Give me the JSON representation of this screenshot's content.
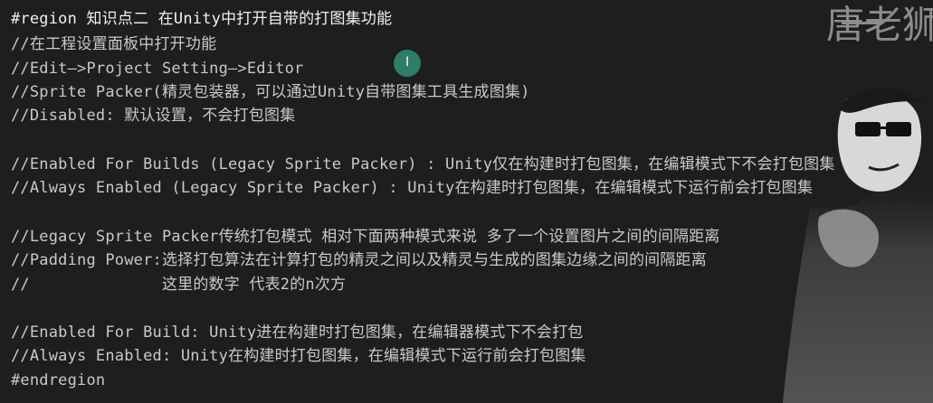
{
  "editor": {
    "lines": [
      {
        "id": "l1",
        "text": "#region 知识点二 在Unity中打开自带的打图集功能",
        "kind": "region-title"
      },
      {
        "id": "l2",
        "text": "//在工程设置面板中打开功能",
        "kind": "comment"
      },
      {
        "id": "l3",
        "text": "//Edit—>Project Setting—>Editor",
        "kind": "comment"
      },
      {
        "id": "l4",
        "text": "//Sprite Packer(精灵包装器，可以通过Unity自带图集工具生成图集)",
        "kind": "comment"
      },
      {
        "id": "l5",
        "text": "//Disabled: 默认设置，不会打包图集",
        "kind": "comment"
      },
      {
        "id": "l6",
        "text": "//Enabled For Builds (Legacy Sprite Packer) : Unity仅在构建时打包图集，在编辑模式下不会打包图集",
        "kind": "comment"
      },
      {
        "id": "l7",
        "text": "//Always Enabled (Legacy Sprite Packer) : Unity在构建时打包图集，在编辑模式下运行前会打包图集",
        "kind": "comment"
      },
      {
        "id": "l8",
        "text": "//Legacy Sprite Packer传统打包模式 相对下面两种模式来说 多了一个设置图片之间的间隔距离",
        "kind": "comment"
      },
      {
        "id": "l9",
        "text": "//Padding Power:选择打包算法在计算打包的精灵之间以及精灵与生成的图集边缘之间的间隔距离",
        "kind": "comment"
      },
      {
        "id": "l10",
        "text": "//              这里的数字 代表2的n次方",
        "kind": "comment"
      },
      {
        "id": "l11",
        "text": "//Enabled For Build: Unity进在构建时打包图集，在编辑器模式下不会打包",
        "kind": "comment"
      },
      {
        "id": "l12",
        "text": "//Always Enabled: Unity在构建时打包图集，在编辑模式下运行前会打包图集",
        "kind": "comment"
      },
      {
        "id": "l13",
        "text": "#endregion",
        "kind": "directive"
      }
    ]
  },
  "watermark": {
    "text": "唐老狮"
  },
  "colors": {
    "background": "#1e1e1e",
    "comment": "#c9c9c9",
    "cursor_highlight": "#2f8f78"
  }
}
